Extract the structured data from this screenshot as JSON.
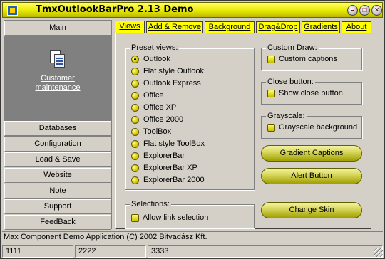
{
  "window": {
    "title": "TmxOutlookBarPro  2.13 Demo",
    "controls": [
      "minimize-icon",
      "maximize-icon",
      "close-icon"
    ]
  },
  "left_panel": {
    "groups": [
      "Main",
      "Databases",
      "Configuration",
      "Load & Save",
      "Website",
      "Note",
      "Support",
      "FeedBack"
    ],
    "main_item": {
      "line1": "Customer",
      "line2": "maintenance",
      "icon": "documents-icon"
    }
  },
  "tabs": [
    "Views",
    "Add & Remove",
    "Background",
    "Drag&Drop",
    "Gradients",
    "About"
  ],
  "active_tab": "Views",
  "preset_views": {
    "title": "Preset views:",
    "options": [
      "Outlook",
      "Flat style Outlook",
      "Outlook Express",
      "Office",
      "Office XP",
      "Office 2000",
      "ToolBox",
      "Flat style ToolBox",
      "ExplorerBar",
      "ExplorerBar XP",
      "ExplorerBar 2000"
    ],
    "selected": "Outlook"
  },
  "selections": {
    "title": "Selections:",
    "checkbox_label": "Allow link selection"
  },
  "custom_draw": {
    "title": "Custom Draw:",
    "checkbox_label": "Custom captions"
  },
  "close_button": {
    "title": "Close button:",
    "checkbox_label": "Show close button"
  },
  "grayscale": {
    "title": "Grayscale:",
    "checkbox_label": "Grayscale background"
  },
  "buttons": {
    "gradient": "Gradient Captions",
    "alert": "Alert Button",
    "skin": "Change Skin"
  },
  "status_text": "Max Component Demo Application (C) 2002 Bitvadász Kft.",
  "status_panels": [
    "1111",
    "2222",
    "3333"
  ],
  "colors": {
    "accent": "#ffff00",
    "panel": "#808080",
    "face": "#d4d0c8"
  }
}
